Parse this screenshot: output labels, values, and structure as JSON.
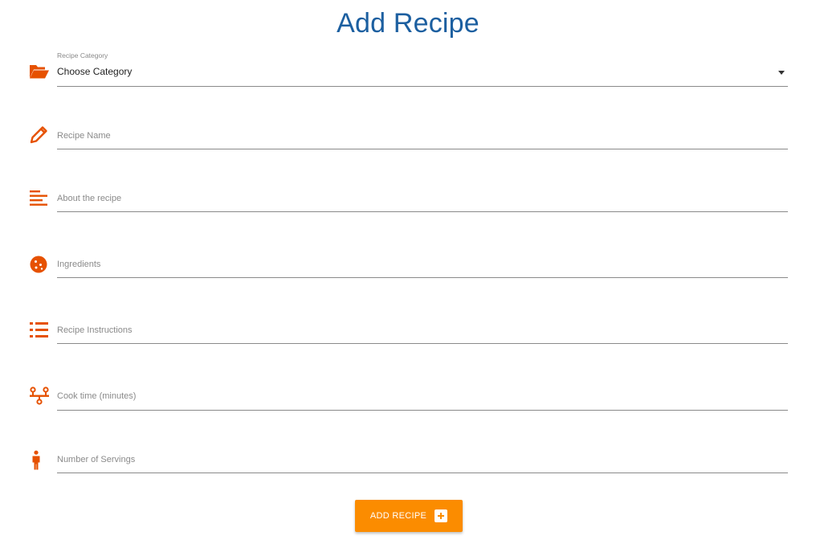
{
  "page": {
    "title": "Add Recipe"
  },
  "form": {
    "category": {
      "label": "Recipe Category",
      "value": "Choose Category",
      "icon": "folder-open-icon"
    },
    "name": {
      "placeholder": "Recipe Name",
      "icon": "pencil-icon"
    },
    "about": {
      "placeholder": "About the recipe",
      "icon": "text-align-left-icon"
    },
    "ingredients": {
      "placeholder": "Ingredients",
      "icon": "cookie-icon"
    },
    "instructions": {
      "placeholder": "Recipe Instructions",
      "icon": "list-icon"
    },
    "cook_time": {
      "placeholder": "Cook time (minutes)",
      "icon": "timeline-icon"
    },
    "servings": {
      "placeholder": "Number of Servings",
      "icon": "person-icon"
    },
    "submit": {
      "label": "ADD RECIPE",
      "icon": "plus-box-icon"
    }
  },
  "colors": {
    "accent": "#e65100",
    "title": "#1c5fa0",
    "button": "#fb8c00"
  }
}
